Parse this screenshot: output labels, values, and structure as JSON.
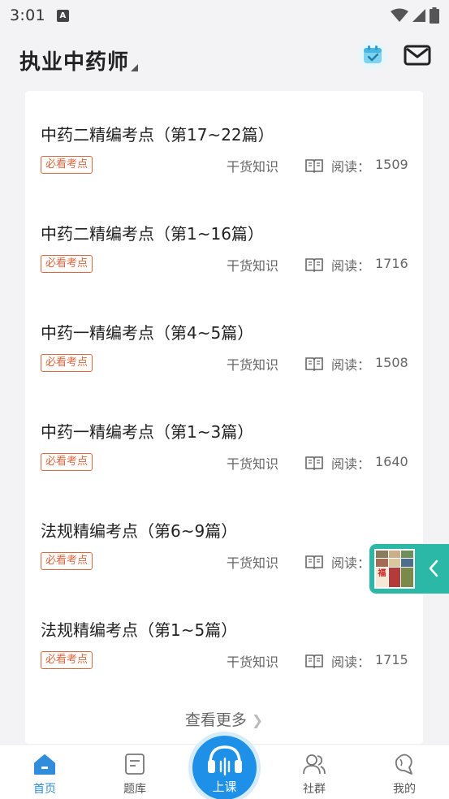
{
  "status_bar": {
    "time": "3:01",
    "notification_icon": "A"
  },
  "header": {
    "title": "执业中药师",
    "calendar_icon": "calendar-check-icon",
    "mail_icon": "mail-icon"
  },
  "articles": [
    {
      "title": "中药二精编考点（第17~22篇）",
      "tag": "必看考点",
      "category": "干货知识",
      "reads_label": "阅读：",
      "reads": "1509"
    },
    {
      "title": "中药二精编考点（第1~16篇）",
      "tag": "必看考点",
      "category": "干货知识",
      "reads_label": "阅读：",
      "reads": "1716"
    },
    {
      "title": "中药一精编考点（第4~5篇）",
      "tag": "必看考点",
      "category": "干货知识",
      "reads_label": "阅读：",
      "reads": "1508"
    },
    {
      "title": "中药一精编考点（第1~3篇）",
      "tag": "必看考点",
      "category": "干货知识",
      "reads_label": "阅读：",
      "reads": "1640"
    },
    {
      "title": "法规精编考点（第6~9篇）",
      "tag": "必看考点",
      "category": "干货知识",
      "reads_label": "阅读：",
      "reads": ""
    },
    {
      "title": "法规精编考点（第1~5篇）",
      "tag": "必看考点",
      "category": "干货知识",
      "reads_label": "阅读：",
      "reads": "1715"
    }
  ],
  "more_link": "查看更多",
  "float_widget": {
    "photo_text": "福"
  },
  "bottom_nav": {
    "home": "首页",
    "question_bank": "题库",
    "lesson": "上课",
    "community": "社群",
    "mine": "我的"
  },
  "colors": {
    "accent": "#1e90e8",
    "tag": "#e0643c",
    "teal": "#2bb8a6",
    "active_tab": "#2f8ddb"
  }
}
